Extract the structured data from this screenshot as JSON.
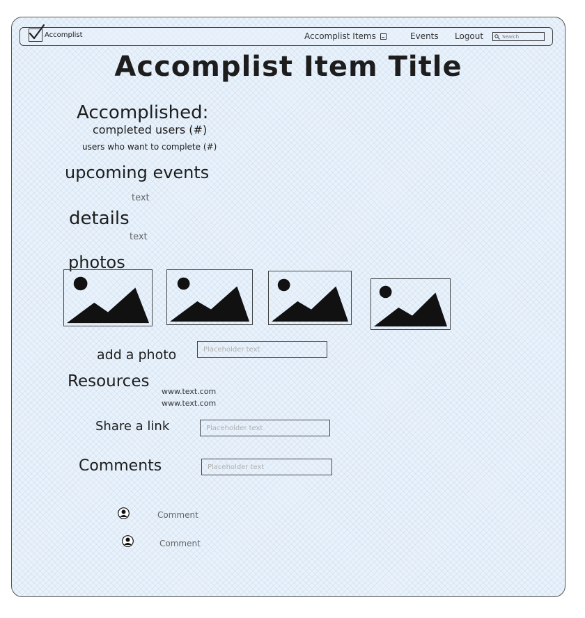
{
  "nav": {
    "logo_text": "Accomplist",
    "items_label": "Accomplist Items",
    "events_label": "Events",
    "logout_label": "Logout",
    "search_placeholder": "Search"
  },
  "page": {
    "title": "Accomplist Item Title"
  },
  "accomplished": {
    "heading": "Accomplished:",
    "completed_users": "completed users (#)",
    "want_to_complete": "users who want to complete (#)"
  },
  "upcoming_events": {
    "heading": "upcoming events",
    "text": "text"
  },
  "details": {
    "heading": "details",
    "text": "text"
  },
  "photos": {
    "heading": "photos",
    "count": 4,
    "add_label": "add a photo",
    "add_placeholder": "Placeholder text"
  },
  "resources": {
    "heading": "Resources",
    "links": [
      "www.text.com",
      "www.text.com"
    ]
  },
  "share": {
    "label": "Share a link",
    "placeholder": "Placeholder text"
  },
  "comments": {
    "heading": "Comments",
    "placeholder": "Placeholder text",
    "items": [
      {
        "text": "Comment"
      },
      {
        "text": "Comment"
      }
    ]
  },
  "colors": {
    "background": "#e9f2fb",
    "ink": "#1d1d1d",
    "muted": "#666666"
  },
  "icons": [
    "checkmark-logo-icon",
    "chevron-down-icon",
    "search-icon",
    "image-placeholder-icon",
    "user-avatar-icon"
  ]
}
